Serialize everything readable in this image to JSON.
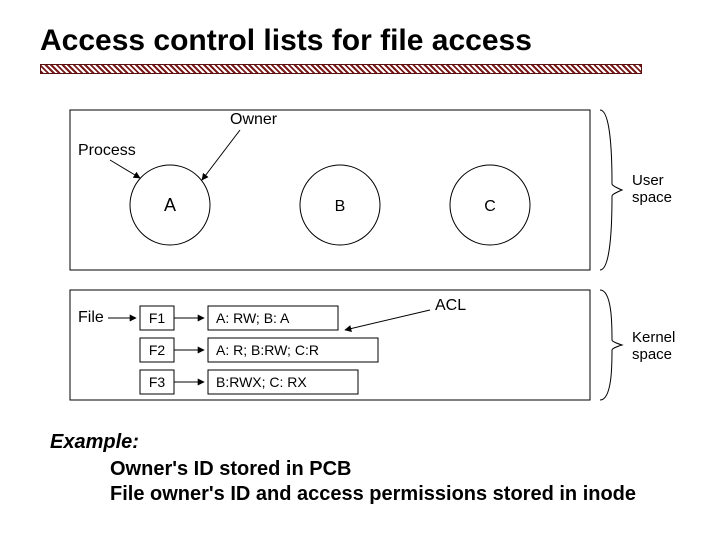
{
  "title": "Access control lists for file access",
  "labels": {
    "process": "Process",
    "owner": "Owner",
    "file": "File",
    "acl": "ACL",
    "user_space": "User\nspace",
    "kernel_space": "Kernel\nspace"
  },
  "processes": [
    "A",
    "B",
    "C"
  ],
  "files": [
    {
      "name": "F1",
      "acl": "A: RW;  B: A"
    },
    {
      "name": "F2",
      "acl": "A: R;  B:RW;  C:R"
    },
    {
      "name": "F3",
      "acl": "B:RWX;  C: RX"
    }
  ],
  "example": {
    "heading": "Example:",
    "line1": "Owner's ID stored in PCB",
    "line2": "File owner's ID and access permissions stored in inode"
  }
}
